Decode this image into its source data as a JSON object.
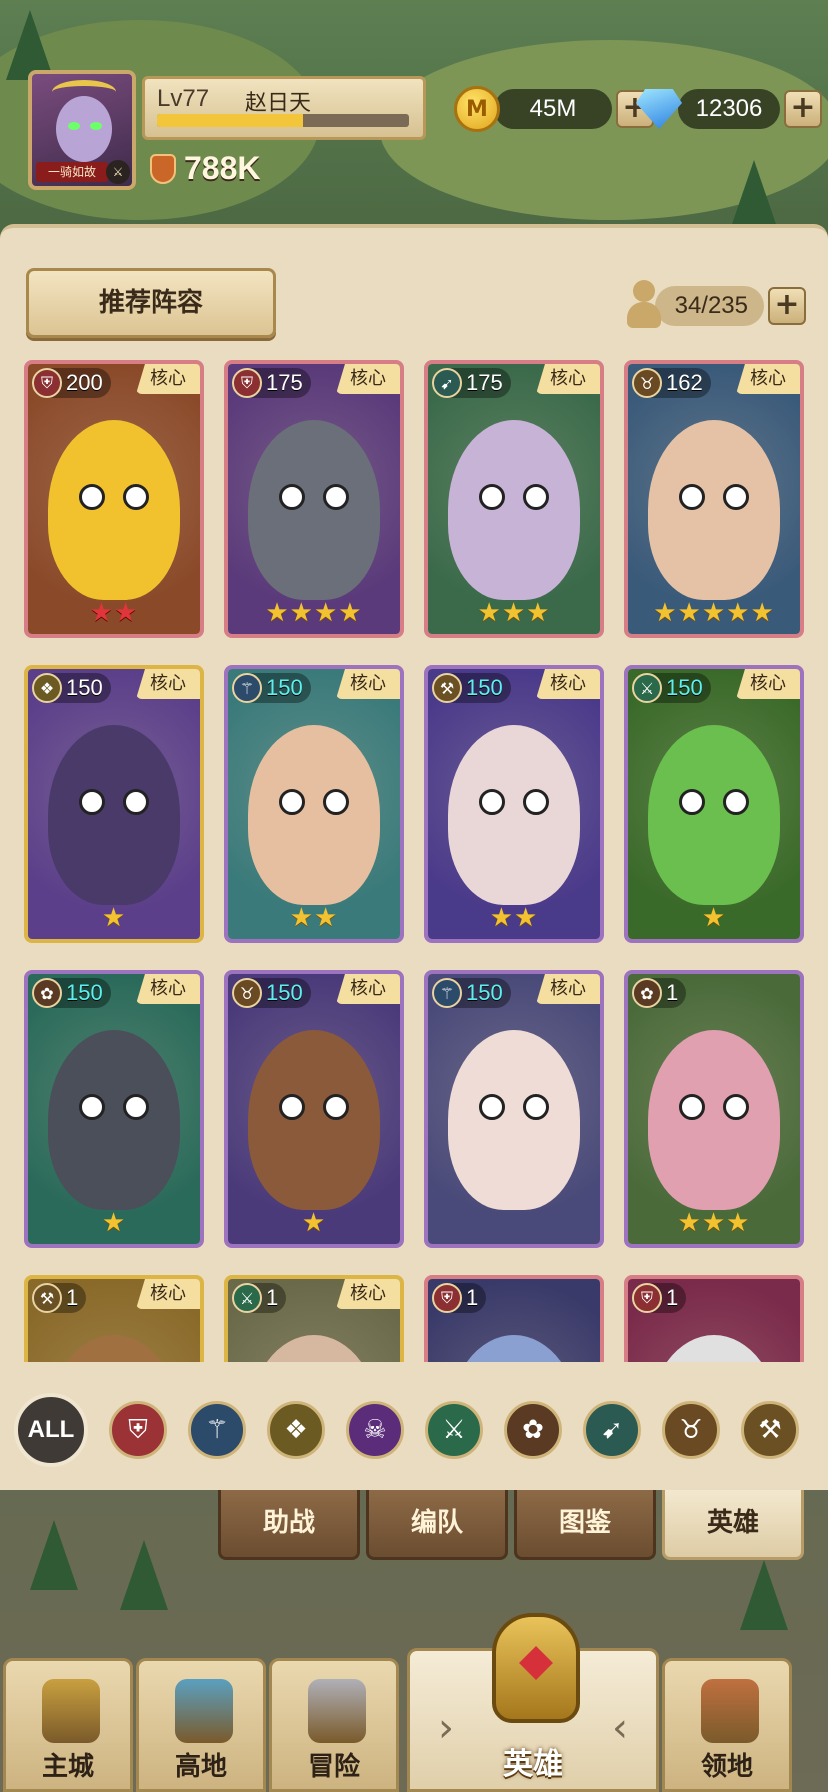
{
  "player": {
    "level": "Lv77",
    "name": "赵日天",
    "avatar_tag": "一骑如故",
    "xp_fraction": 0.58,
    "power": "788K"
  },
  "currency": {
    "gold": {
      "icon": "coin-icon",
      "value": "45M"
    },
    "gems": {
      "icon": "diamond-icon",
      "value": "12306"
    }
  },
  "panel": {
    "recommend_label": "推荐阵容",
    "capacity": "34/235"
  },
  "heroes": [
    {
      "level": "200",
      "core": "核心",
      "class_icon": "shield-icon",
      "stars": "★★",
      "star_color": "red"
    },
    {
      "level": "175",
      "core": "核心",
      "class_icon": "shield-icon",
      "stars": "★★★★",
      "star_color": "gold"
    },
    {
      "level": "175",
      "core": "核心",
      "class_icon": "bow-icon",
      "stars": "★★★",
      "star_color": "gold"
    },
    {
      "level": "162",
      "core": "核心",
      "class_icon": "horned-skull-icon",
      "stars": "★★★★★",
      "star_color": "gold"
    },
    {
      "level": "150",
      "core": "核心",
      "class_icon": "winged-emblem-icon",
      "stars": "★",
      "star_color": "gold"
    },
    {
      "level": "150",
      "core": "核心",
      "class_icon": "staff-icon",
      "stars": "★★",
      "star_color": "gold"
    },
    {
      "level": "150",
      "core": "核心",
      "class_icon": "hammer-icon",
      "stars": "★★",
      "star_color": "gold"
    },
    {
      "level": "150",
      "core": "核心",
      "class_icon": "crossed-swords-icon",
      "stars": "★",
      "star_color": "gold"
    },
    {
      "level": "150",
      "core": "核心",
      "class_icon": "paw-icon",
      "stars": "★",
      "star_color": "gold"
    },
    {
      "level": "150",
      "core": "核心",
      "class_icon": "horned-skull-icon",
      "stars": "★",
      "star_color": "gold"
    },
    {
      "level": "150",
      "core": "核心",
      "class_icon": "staff-icon",
      "stars": "",
      "star_color": "gold"
    },
    {
      "level": "1",
      "core": "",
      "class_icon": "paw-icon",
      "stars": "★★★",
      "star_color": "gold"
    },
    {
      "level": "1",
      "core": "核心",
      "class_icon": "hammer-icon",
      "stars": "",
      "star_color": "gold"
    },
    {
      "level": "1",
      "core": "核心",
      "class_icon": "crossed-swords-icon",
      "stars": "",
      "star_color": "gold"
    },
    {
      "level": "1",
      "core": "",
      "class_icon": "shield-icon",
      "stars": "",
      "star_color": "gold"
    },
    {
      "level": "1",
      "core": "",
      "class_icon": "shield-icon",
      "stars": "",
      "star_color": "gold"
    }
  ],
  "filters": {
    "all_label": "ALL",
    "classes": [
      {
        "icon": "shield-icon",
        "color": "#9a3236"
      },
      {
        "icon": "staff-icon",
        "color": "#2c4a6a"
      },
      {
        "icon": "winged-emblem-icon",
        "color": "#6b5a22"
      },
      {
        "icon": "skull-icon",
        "color": "#5a2c7a"
      },
      {
        "icon": "crossed-swords-icon",
        "color": "#2a6a4a"
      },
      {
        "icon": "paw-icon",
        "color": "#5a3a22"
      },
      {
        "icon": "bow-icon",
        "color": "#2a5a52"
      },
      {
        "icon": "horned-skull-icon",
        "color": "#6a4a22"
      },
      {
        "icon": "hammer-icon",
        "color": "#6a5022"
      }
    ]
  },
  "subtabs": [
    {
      "label": "助战",
      "active": false
    },
    {
      "label": "编队",
      "active": false
    },
    {
      "label": "图鉴",
      "active": false
    },
    {
      "label": "英雄",
      "active": true
    }
  ],
  "bottom_nav": [
    {
      "label": "主城",
      "icon": "castle-icon"
    },
    {
      "label": "高地",
      "icon": "fountain-icon"
    },
    {
      "label": "冒险",
      "icon": "crossed-swords-icon"
    },
    {
      "label": "英雄",
      "icon": "helmet-icon",
      "active": true
    },
    {
      "label": "领地",
      "icon": "banner-icon"
    }
  ]
}
